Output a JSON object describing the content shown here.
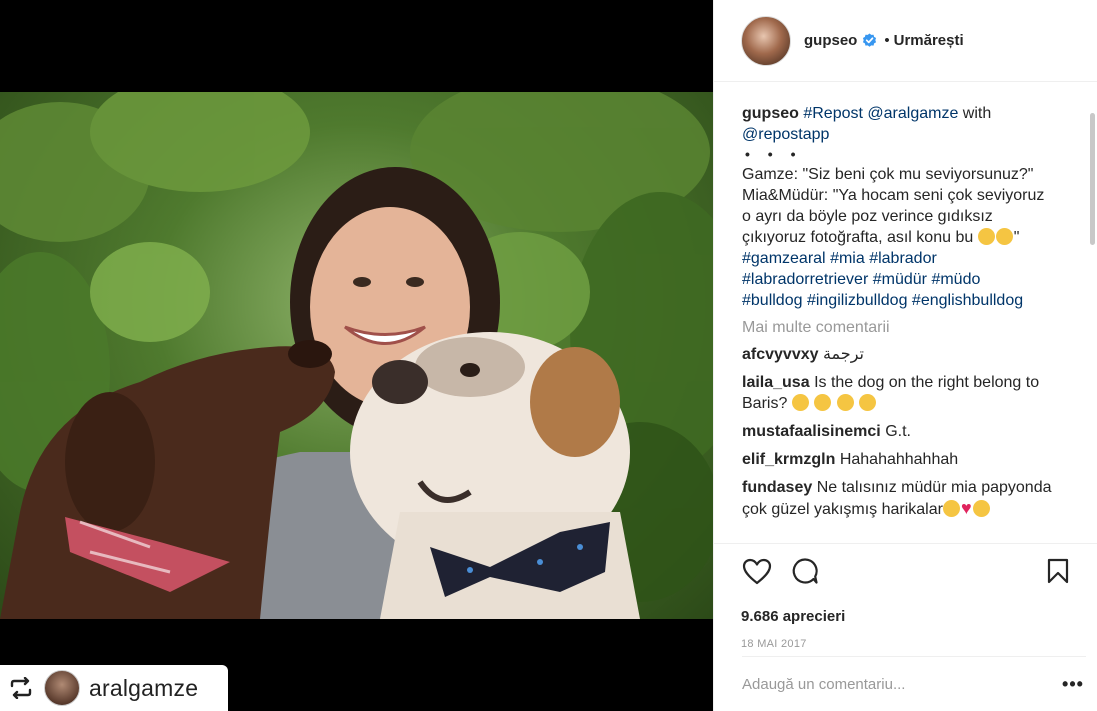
{
  "header": {
    "username": "gupseo",
    "follow_label": "Urmărești",
    "separator": "•"
  },
  "caption": {
    "username": "gupseo",
    "repost_tag": "#Repost",
    "mention": "@aralgamze",
    "with_word": "with",
    "app_mention": "@repostapp",
    "dots": "• • •",
    "line1": "Gamze: \"Siz beni çok mu seviyorsunuz?\"",
    "line2": "Mia&Müdür: \"Ya hocam seni çok seviyoruz",
    "line3": "o ayrı da böyle poz verince gıdıksız",
    "line4_text": "çıkıyoruz fotoğrafta, asıl konu bu",
    "line4_end": "\"",
    "tags1": [
      "#gamzearal",
      "#mia",
      "#labrador"
    ],
    "tags2": [
      "#labradorretriever",
      "#müdür",
      "#müdo"
    ],
    "tags3": [
      "#bulldog",
      "#ingilizbulldog",
      "#englishbulldog"
    ]
  },
  "more_comments_label": "Mai multe comentarii",
  "comments": [
    {
      "user": "afcvyvvxy",
      "text": "ترجمة"
    },
    {
      "user": "laila_usa",
      "text": "Is the dog on the right belong to",
      "text2": "Baris?"
    },
    {
      "user": "mustafaalisinemci",
      "text": "G.t."
    },
    {
      "user": "elif_krmzgln",
      "text": "Hahahahhahhah"
    },
    {
      "user": "fundasey",
      "text": "Ne talısınız müdür mia papyonda",
      "text2": "çok güzel yakışmış harikalar"
    }
  ],
  "actions": {
    "like_icon": "heart-outline-icon",
    "comment_icon": "speech-bubble-icon",
    "save_icon": "bookmark-icon"
  },
  "likes_label": "9.686 aprecieri",
  "date_label": "18 MAI 2017",
  "add_comment_placeholder": "Adaugă un comentariu...",
  "options_label": "•••",
  "repost_overlay": {
    "username": "aralgamze",
    "icon": "repost-icon"
  },
  "colors": {
    "link": "#003569",
    "verified": "#3897f0",
    "muted": "#999999",
    "text": "#262626"
  }
}
